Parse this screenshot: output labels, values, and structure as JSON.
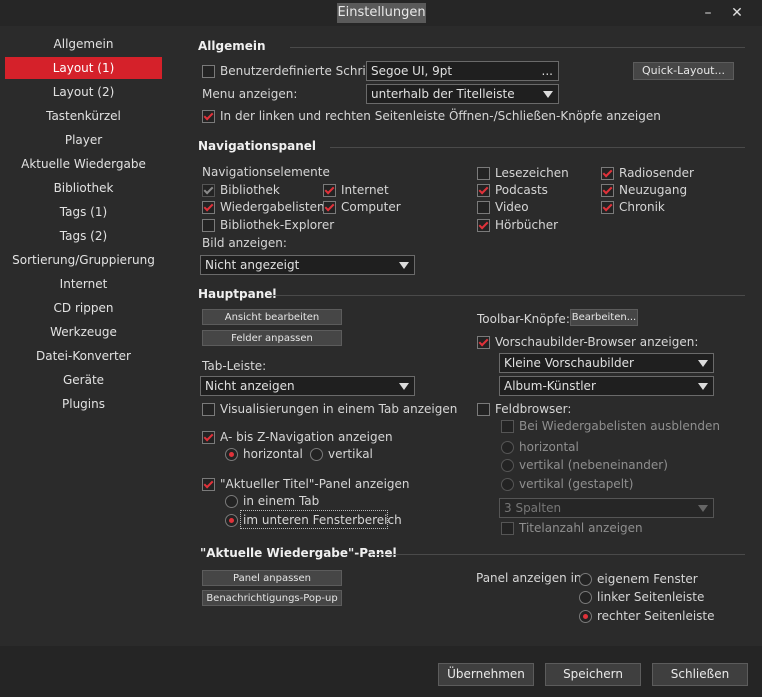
{
  "window": {
    "title": "Einstellungen",
    "minimize": "–",
    "close": "✕"
  },
  "sidebar": {
    "items": [
      {
        "label": "Allgemein"
      },
      {
        "label": "Layout (1)"
      },
      {
        "label": "Layout (2)"
      },
      {
        "label": "Tastenkürzel"
      },
      {
        "label": "Player"
      },
      {
        "label": "Aktuelle Wiedergabe"
      },
      {
        "label": "Bibliothek"
      },
      {
        "label": "Tags (1)"
      },
      {
        "label": "Tags (2)"
      },
      {
        "label": "Sortierung/Gruppierung"
      },
      {
        "label": "Internet"
      },
      {
        "label": "CD rippen"
      },
      {
        "label": "Werkzeuge"
      },
      {
        "label": "Datei-Konverter"
      },
      {
        "label": "Geräte"
      },
      {
        "label": "Plugins"
      }
    ]
  },
  "allgemein": {
    "title": "Allgemein",
    "custom_font_label": "Benutzerdefinierte Schrift:",
    "font_value": "Segoe UI, 9pt",
    "font_dots": "...",
    "quick_layout": "Quick-Layout...",
    "menu_label": "Menu anzeigen:",
    "menu_value": "unterhalb der Titelleiste",
    "sidebar_buttons_label": "In der linken und rechten Seitenleiste Öffnen-/Schließen-Knöpfe anzeigen"
  },
  "nav": {
    "title": "Navigationspanel",
    "elements_label": "Navigationselemente",
    "bibliothek": "Bibliothek",
    "internet": "Internet",
    "wiedergabelisten": "Wiedergabelisten",
    "computer": "Computer",
    "explorer": "Bibliothek-Explorer",
    "lesezeichen": "Lesezeichen",
    "podcasts": "Podcasts",
    "video": "Video",
    "hoerbuecher": "Hörbücher",
    "radiosender": "Radiosender",
    "neuzugang": "Neuzugang",
    "chronik": "Chronik",
    "bild_label": "Bild anzeigen:",
    "bild_value": "Nicht angezeigt"
  },
  "haupt": {
    "title": "Hauptpanel",
    "ansicht_btn": "Ansicht bearbeiten",
    "felder_btn": "Felder anpassen",
    "tab_label": "Tab-Leiste:",
    "tab_value": "Nicht anzeigen",
    "vis_label": "Visualisierungen in einem Tab anzeigen",
    "az_label": "A- bis Z-Navigation anzeigen",
    "horizontal": "horizontal",
    "vertikal": "vertikal",
    "aktueller_label": "\"Aktueller Titel\"-Panel anzeigen",
    "in_tab": "in einem Tab",
    "unteren": "im unteren Fensterbereich",
    "toolbar_label": "Toolbar-Knöpfe:",
    "toolbar_btn": "Bearbeiten...",
    "vorschau_label": "Vorschaubilder-Browser anzeigen:",
    "vorschau_value1": "Kleine Vorschaubilder",
    "vorschau_value2": "Album-Künstler",
    "feldbrowser_label": "Feldbrowser:",
    "bei_wiedergabe": "Bei Wiedergabelisten ausblenden",
    "fb_horizontal": "horizontal",
    "fb_nebeneinander": "vertikal (nebeneinander)",
    "fb_gestapelt": "vertikal (gestapelt)",
    "spalten_value": "3 Spalten",
    "titelanzahl": "Titelanzahl anzeigen"
  },
  "aktuelle": {
    "title": "\"Aktuelle Wiedergabe\"-Panel",
    "panel_btn": "Panel anpassen",
    "popup_btn": "Benachrichtigungs-Pop-up",
    "anzeigen_label": "Panel anzeigen in:",
    "eigenem": "eigenem Fenster",
    "linker": "linker Seitenleiste",
    "rechter": "rechter Seitenleiste"
  },
  "footer": {
    "apply": "Übernehmen",
    "save": "Speichern",
    "close": "Schließen"
  }
}
